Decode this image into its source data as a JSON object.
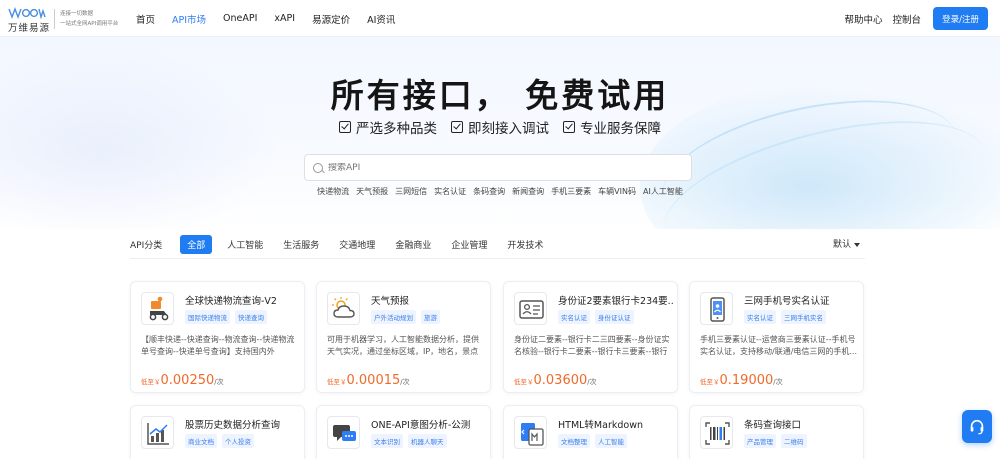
{
  "nav": {
    "logo_cn": "万维易源",
    "logo_tag1": "连接一切数据",
    "logo_tag2": "一站式全网API调用平台",
    "links": [
      {
        "label": "首页",
        "active": false
      },
      {
        "label": "API市场",
        "active": true
      },
      {
        "label": "OneAPI",
        "active": false
      },
      {
        "label": "xAPI",
        "active": false
      },
      {
        "label": "易源定价",
        "active": false
      },
      {
        "label": "AI资讯",
        "active": false
      }
    ],
    "help": "帮助中心",
    "console": "控制台",
    "login": "登录/注册"
  },
  "hero": {
    "title": "所有接口， 免费试用",
    "features": [
      "严选多种品类",
      "即刻接入调试",
      "专业服务保障"
    ],
    "search_placeholder": "搜索API",
    "hot_tags": [
      "快递物流",
      "天气预报",
      "三网短信",
      "实名认证",
      "条码查询",
      "新闻查询",
      "手机三要素",
      "车辆VIN码",
      "AI人工智能"
    ]
  },
  "categories": {
    "label": "API分类",
    "tabs": [
      "全部",
      "人工智能",
      "生活服务",
      "交通地理",
      "金融商业",
      "企业管理",
      "开发技术"
    ],
    "active": "全部",
    "sort": "默认"
  },
  "cards": [
    {
      "title": "全球快递物流查询-V2",
      "tags": [
        "国际快递物流",
        "快递查询"
      ],
      "desc": "【顺丰快递--快递查询--物流查询--快递物流单号查询--快递单号查询】支持国内外1500...",
      "price_pre": "低至￥",
      "price": "0.00250",
      "unit": "/次",
      "icon": "courier-icon"
    },
    {
      "title": "天气预报",
      "tags": [
        "户外活动规划",
        "旅游"
      ],
      "desc": "可用于机器学习，人工智能数据分析，提供天气实况，通过坐标区域，IP，地名，景点名...",
      "price_pre": "低至￥",
      "price": "0.00015",
      "unit": "/次",
      "icon": "weather-icon"
    },
    {
      "title": "身份证2要素银行卡234要...",
      "tags": [
        "实名认证",
        "身份证认证"
      ],
      "desc": "身份证二要素--银行卡二三四要素--身份证实名核验--银行卡二要素--银行卡三要素--银行卡...",
      "price_pre": "低至￥",
      "price": "0.03600",
      "unit": "/次",
      "icon": "id-card-icon"
    },
    {
      "title": "三网手机号实名认证",
      "tags": [
        "实名认证",
        "三网手机实名"
      ],
      "desc": "手机三要素认证--运营商三要素认证--手机号实名认证，支持移动/联通/电信三网的手机...",
      "price_pre": "低至￥",
      "price": "0.19000",
      "unit": "/次",
      "icon": "phone-icon"
    },
    {
      "title": "股票历史数据分析查询",
      "tags": [
        "商业文档",
        "个人投资"
      ],
      "icon": "stock-chart-icon"
    },
    {
      "title": "ONE-API意图分析-公测",
      "tags": [
        "文本识别",
        "机器人聊天"
      ],
      "icon": "chat-icon"
    },
    {
      "title": "HTML转Markdown",
      "tags": [
        "文档整理",
        "人工智能"
      ],
      "icon": "markdown-icon"
    },
    {
      "title": "条码查询接口",
      "tags": [
        "产品管理",
        "二维码"
      ],
      "icon": "barcode-icon"
    }
  ],
  "colors": {
    "brand": "#1f7cf2",
    "price": "#f06a2b",
    "tag_text": "#3a7ee8",
    "tag_bg": "#eef4ff"
  }
}
